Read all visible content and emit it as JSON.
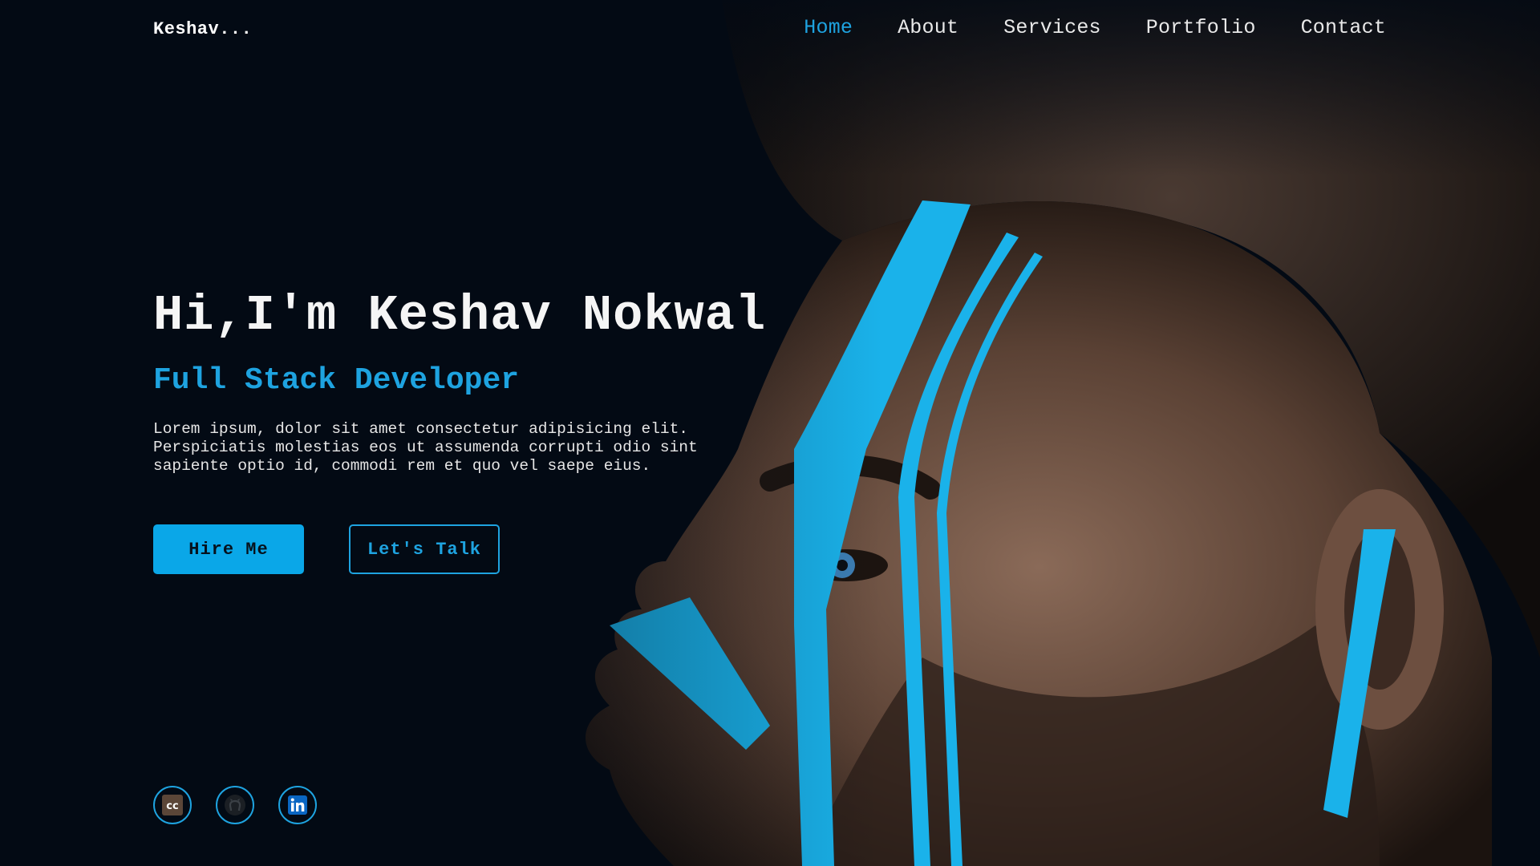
{
  "brand": {
    "logo_text": "Keshav...",
    "accent_color": "#1ea3e0"
  },
  "nav": {
    "items": [
      {
        "label": "Home",
        "active": true
      },
      {
        "label": "About",
        "active": false
      },
      {
        "label": "Services",
        "active": false
      },
      {
        "label": "Portfolio",
        "active": false
      },
      {
        "label": "Contact",
        "active": false
      }
    ]
  },
  "hero": {
    "greeting": "Hi,I'm Keshav Nokwal",
    "role": "Full Stack Developer",
    "description": "Lorem ipsum, dolor sit amet consectetur adipisicing elit. Perspiciatis molestias eos ut assumenda corrupti odio sint sapiente optio id, commodi rem et quo vel saepe eius.",
    "primary_button": "Hire Me",
    "secondary_button": "Let's Talk"
  },
  "socials": [
    {
      "icon": "codechef-icon"
    },
    {
      "icon": "github-icon"
    },
    {
      "icon": "linkedin-icon"
    }
  ],
  "background": {
    "icon": "portrait-with-blue-face-paint"
  }
}
